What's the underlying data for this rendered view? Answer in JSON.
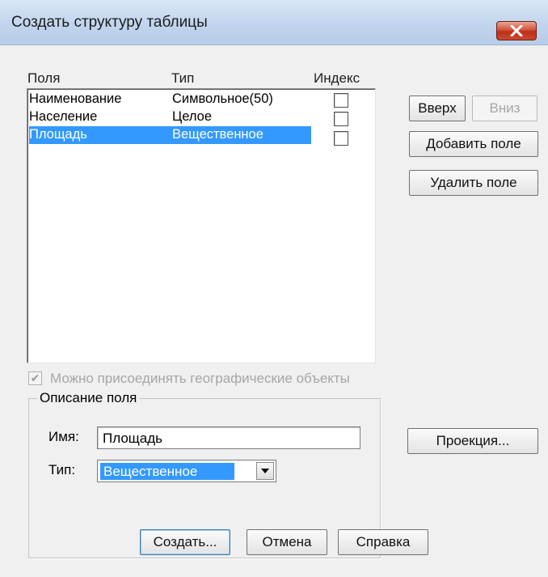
{
  "window": {
    "title": "Создать структуру таблицы"
  },
  "fields_list": {
    "headers": {
      "field": "Поля",
      "type": "Тип",
      "index": "Индекс"
    },
    "rows": [
      {
        "name": "Наименование",
        "type": "Символьное(50)",
        "indexed": false,
        "selected": false
      },
      {
        "name": "Население",
        "type": "Целое",
        "indexed": false,
        "selected": false
      },
      {
        "name": "Площадь",
        "type": "Вещественное",
        "indexed": false,
        "selected": true
      }
    ]
  },
  "buttons": {
    "up": "Вверх",
    "down": "Вниз",
    "add_field": "Добавить поле",
    "delete_field": "Удалить поле",
    "projection": "Проекция...",
    "create": "Создать...",
    "cancel": "Отмена",
    "help": "Справка"
  },
  "geo_option": {
    "label": "Можно присоединять географические объекты",
    "checked": true,
    "enabled": false
  },
  "field_description": {
    "title": "Описание поля",
    "name_label": "Имя:",
    "name_value": "Площадь",
    "type_label": "Тип:",
    "type_value": "Вещественное"
  },
  "colors": {
    "selection": "#3399ff",
    "close_button": "#c94a33"
  }
}
